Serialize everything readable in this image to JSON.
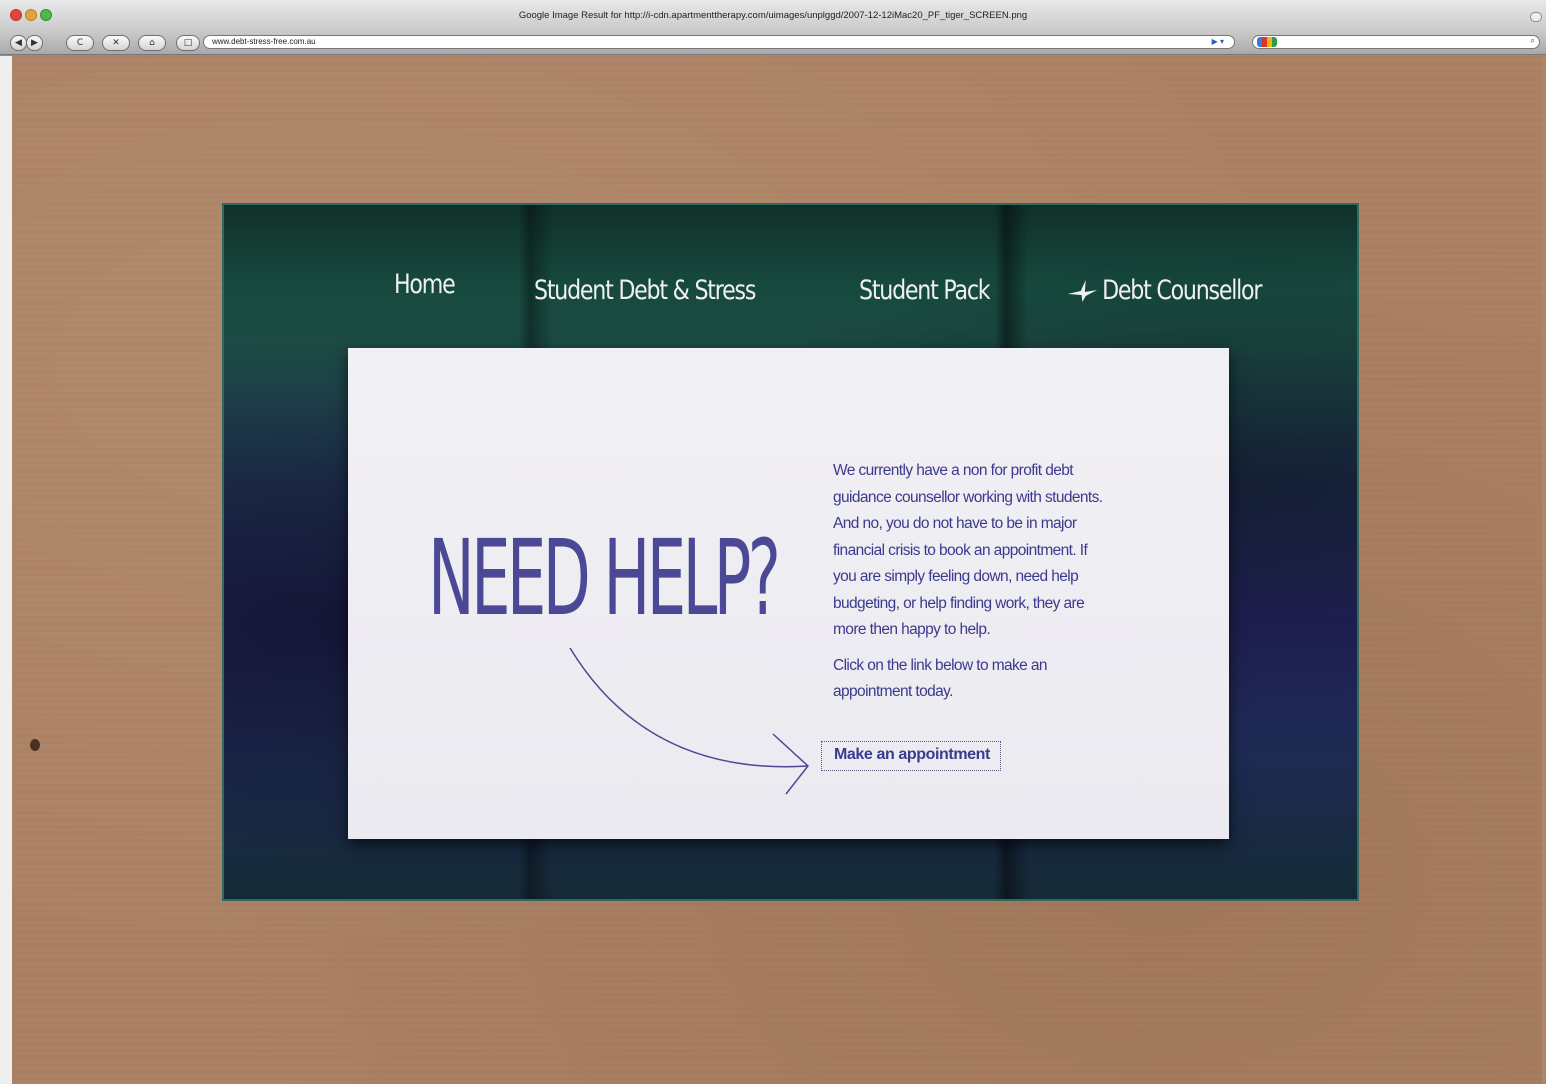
{
  "browser": {
    "window_title": "Google Image Result for http://i-cdn.apartmenttherapy.com/uimages/unplggd/2007-12-12iMac20_PF_tiger_SCREEN.png",
    "url": "www.debt-stress-free.com.au",
    "buttons": {
      "back": "◀",
      "forward": "▶",
      "reload": "C",
      "stop": "✕",
      "home": "⌂",
      "bookmark": "□"
    },
    "rss_indicator": "▶ ▾",
    "search_value": "",
    "search_icon": "magnifier-icon"
  },
  "site": {
    "nav": {
      "home": "Home",
      "student_debt": "Student Debt & Stress",
      "student_pack": "Student Pack",
      "debt_counsellor": "Debt Counsellor"
    },
    "headline": "NEED HELP?",
    "paragraph_1": "We currently have a non for profit debt guidance counsellor working with students. And no, you do not have to be in major financial crisis to book an appointment. If you are simply feeling down, need help budgeting, or help finding work, they are more then happy to help.",
    "paragraph_2": "Click on the link below to make an appointment today.",
    "cta_link": "Make an appointment"
  },
  "colors": {
    "cardboard": "#ac8264",
    "hero_border": "#2f6a60",
    "accent_text": "#3c3a8e",
    "nav_text": "#f0f0f0"
  }
}
